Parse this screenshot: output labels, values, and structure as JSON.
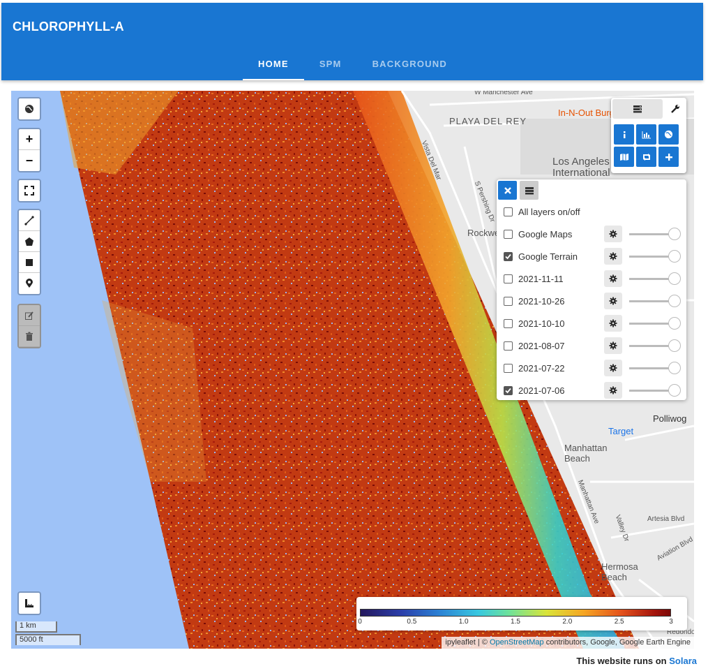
{
  "app": {
    "title": "CHLOROPHYLL-A"
  },
  "tabs": [
    {
      "label": "HOME",
      "active": true
    },
    {
      "label": "SPM",
      "active": false
    },
    {
      "label": "BACKGROUND",
      "active": false
    }
  ],
  "map": {
    "zoom_controls": {
      "in": "+",
      "out": "−"
    },
    "place_labels": [
      "W Manchester Ave",
      "In-N-Out Burger",
      "PLAYA DEL REY",
      "Los Angeles International",
      "Vista Del Mar",
      "S Pershing Dr",
      "Manhattan Beach",
      "Manhattan Ave",
      "Hermosa Beach",
      "Polliwog",
      "Target",
      "Artesia Blvd",
      "Valley Dr",
      "Aviation Blvd",
      "Redondo",
      "Rockwell Beach"
    ],
    "scale": {
      "metric": "1 km",
      "imperial": "5000 ft"
    },
    "attribution": {
      "prefix": "ipyleaflet | ©",
      "osm_link": "OpenStreetMap",
      "suffix": "contributors, Google, Google Earth Engine"
    },
    "colorbar": {
      "ticks": [
        "0",
        "0.5",
        "1.0",
        "1.5",
        "2.0",
        "2.5",
        "3"
      ],
      "min": 0,
      "max": 3
    }
  },
  "layers_panel": {
    "all_label": "All layers on/off",
    "layers": [
      {
        "name": "Google Maps",
        "checked": false,
        "opacity": 1.0
      },
      {
        "name": "Google Terrain",
        "checked": true,
        "opacity": 1.0
      },
      {
        "name": "2021-11-11",
        "checked": false,
        "opacity": 1.0
      },
      {
        "name": "2021-10-26",
        "checked": false,
        "opacity": 1.0
      },
      {
        "name": "2021-10-10",
        "checked": false,
        "opacity": 1.0
      },
      {
        "name": "2021-08-07",
        "checked": false,
        "opacity": 1.0
      },
      {
        "name": "2021-07-22",
        "checked": false,
        "opacity": 1.0
      },
      {
        "name": "2021-07-06",
        "checked": true,
        "opacity": 1.0
      }
    ]
  },
  "footer": {
    "text": "This website runs on",
    "link": "Solara"
  },
  "colors": {
    "primary": "#1976d2",
    "ocean": "#9ec2f7",
    "land": "#e9e9e9"
  }
}
